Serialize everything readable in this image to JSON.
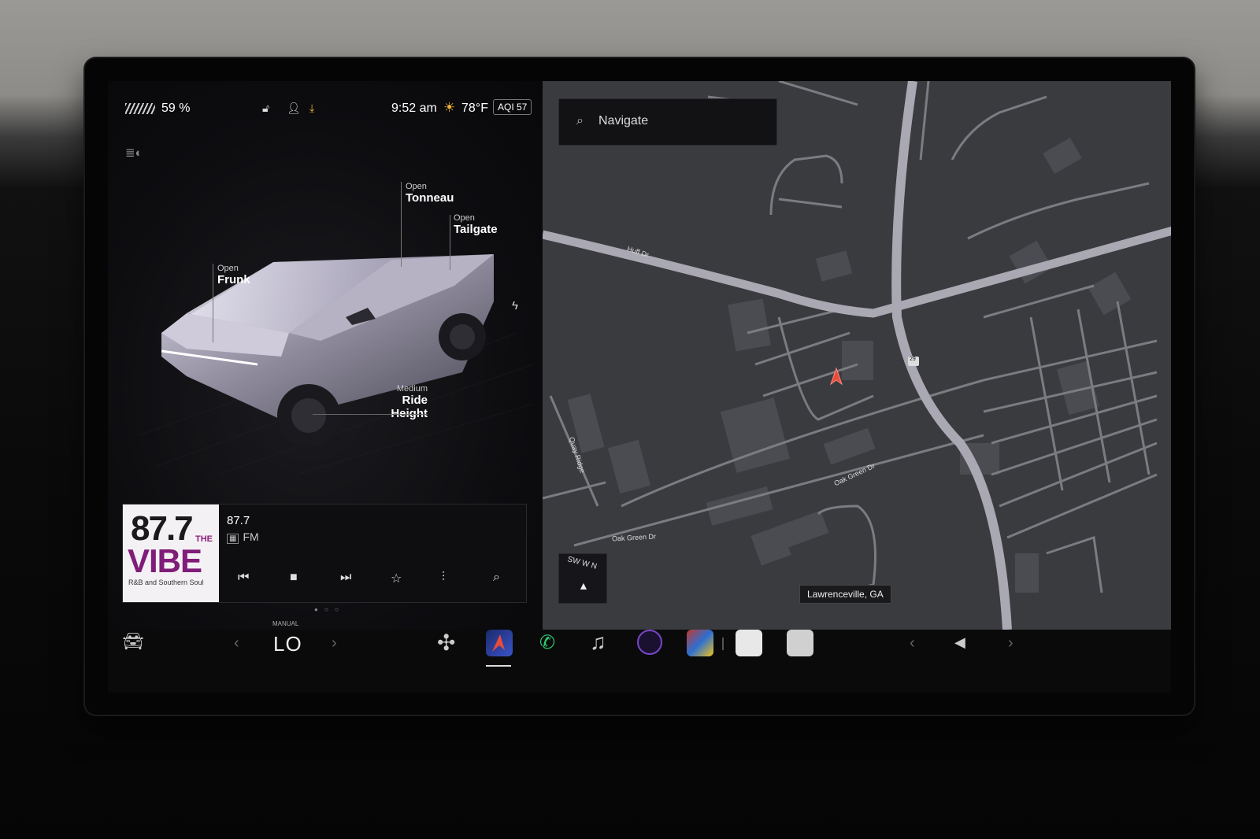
{
  "status": {
    "battery_pct": "59 %",
    "time": "9:52 am",
    "temperature": "78°F",
    "aqi": "AQI 57"
  },
  "vehicle": {
    "tonneau_action": "Open",
    "tonneau_label": "Tonneau",
    "tailgate_action": "Open",
    "tailgate_label": "Tailgate",
    "frunk_action": "Open",
    "frunk_label": "Frunk",
    "ride_height_value": "Medium",
    "ride_height_label": "Ride Height"
  },
  "media": {
    "album_number": "87.7",
    "album_the": "THE",
    "album_name": "VIBE",
    "album_subtitle": "R&B and Southern Soul",
    "station": "87.7",
    "band": "FM"
  },
  "map": {
    "search_placeholder": "Navigate",
    "compass_letters": "SW W N",
    "location": "Lawrenceville, GA",
    "streets": [
      "Huff Dr",
      "Quay Ridge",
      "Oak Green Dr",
      "Oak Green Dr"
    ],
    "route_shield": "29"
  },
  "climate": {
    "mode": "MANUAL",
    "temp": "LO"
  },
  "icons": {
    "car": "car-icon",
    "fan": "fan-icon",
    "nav": "navigation-app-icon",
    "phone": "phone-icon",
    "music": "music-icon",
    "camera": "camera-icon",
    "apps": "apps-icon",
    "calendar": "calendar-icon",
    "notes": "notes-icon",
    "volume": "volume-icon"
  },
  "colors": {
    "sun": "#f1b434",
    "phone": "#2ecc71",
    "nav_arrow": "#e74c3c",
    "album_purple": "#7f1d78"
  }
}
